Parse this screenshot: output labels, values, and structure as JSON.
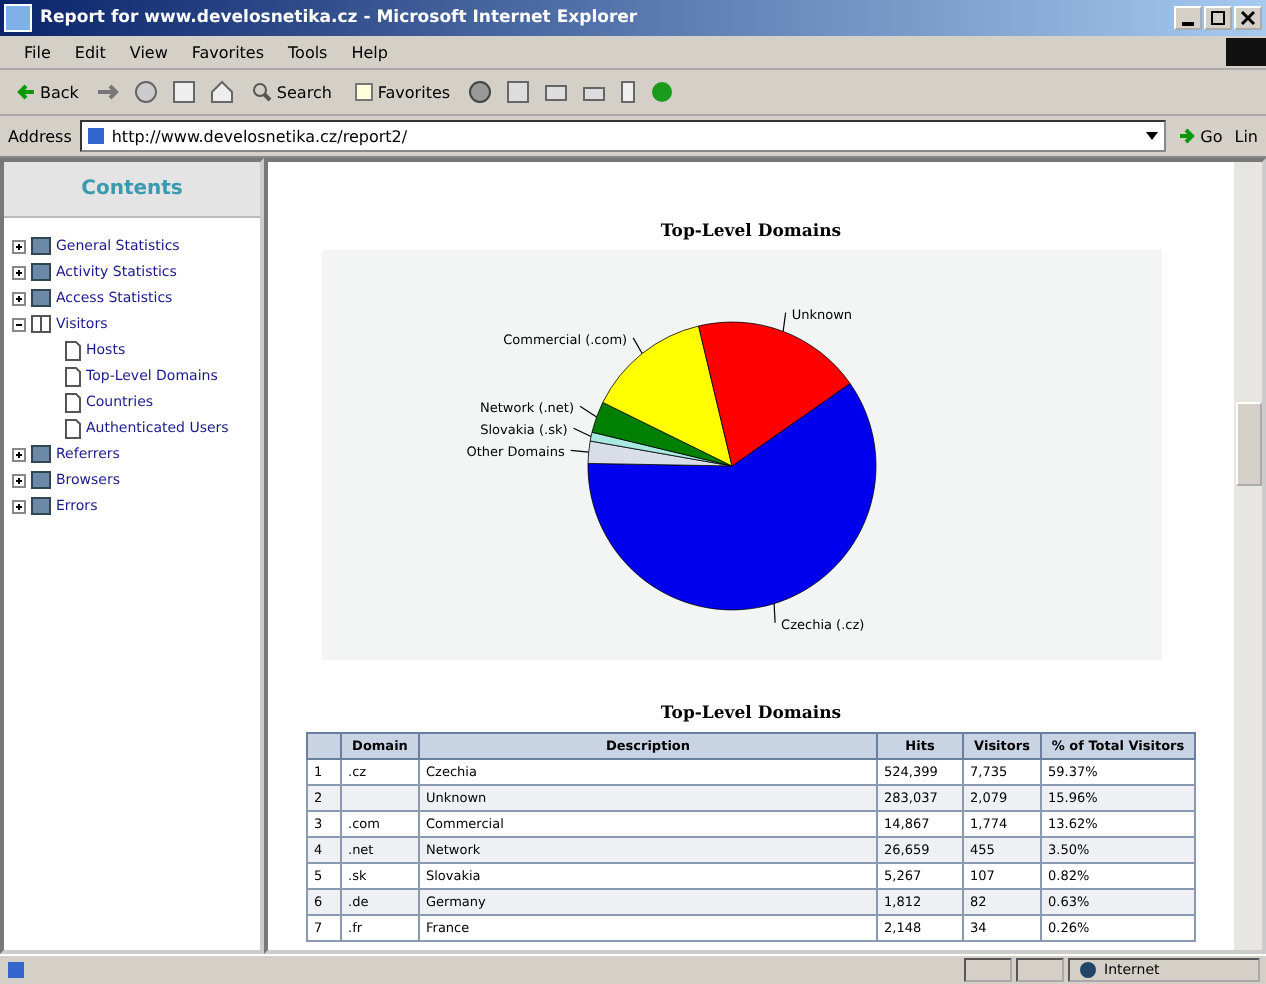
{
  "window": {
    "title": "Report for www.develosnetika.cz - Microsoft Internet Explorer"
  },
  "menu": [
    "File",
    "Edit",
    "View",
    "Favorites",
    "Tools",
    "Help"
  ],
  "toolbar": {
    "back": "Back",
    "search": "Search",
    "favorites": "Favorites"
  },
  "address": {
    "label": "Address",
    "url": "http://www.develosnetika.cz/report2/",
    "go": "Go",
    "links": "Lin"
  },
  "sidebar": {
    "title": "Contents",
    "items": [
      {
        "label": "General Statistics",
        "expanded": false
      },
      {
        "label": "Activity Statistics",
        "expanded": false
      },
      {
        "label": "Access Statistics",
        "expanded": false
      },
      {
        "label": "Visitors",
        "expanded": true,
        "children": [
          {
            "label": "Hosts"
          },
          {
            "label": "Top-Level Domains"
          },
          {
            "label": "Countries"
          },
          {
            "label": "Authenticated Users"
          }
        ]
      },
      {
        "label": "Referrers",
        "expanded": false
      },
      {
        "label": "Browsers",
        "expanded": false
      },
      {
        "label": "Errors",
        "expanded": false
      }
    ]
  },
  "chart": {
    "heading": "Top-Level Domains",
    "chart_data": {
      "type": "pie",
      "categories": [
        "Czechia (.cz)",
        "Other Domains",
        "Slovakia (.sk)",
        "Network (.net)",
        "Commercial (.com)",
        "Unknown"
      ],
      "values": [
        60,
        2.5,
        1,
        3.5,
        14,
        19
      ],
      "colors": [
        "#0000ee",
        "#d8dde8",
        "#a8e8e0",
        "#008000",
        "#ffff00",
        "#ff0000"
      ]
    }
  },
  "table": {
    "heading": "Top-Level Domains",
    "columns": [
      "",
      "Domain",
      "Description",
      "Hits",
      "Visitors",
      "% of Total Visitors"
    ],
    "rows": [
      [
        "1",
        ".cz",
        "Czechia",
        "524,399",
        "7,735",
        "59.37%"
      ],
      [
        "2",
        "",
        "Unknown",
        "283,037",
        "2,079",
        "15.96%"
      ],
      [
        "3",
        ".com",
        "Commercial",
        "14,867",
        "1,774",
        "13.62%"
      ],
      [
        "4",
        ".net",
        "Network",
        "26,659",
        "455",
        "3.50%"
      ],
      [
        "5",
        ".sk",
        "Slovakia",
        "5,267",
        "107",
        "0.82%"
      ],
      [
        "6",
        ".de",
        "Germany",
        "1,812",
        "82",
        "0.63%"
      ],
      [
        "7",
        ".fr",
        "France",
        "2,148",
        "34",
        "0.26%"
      ]
    ]
  },
  "status_bar": {
    "zone": "Internet"
  }
}
